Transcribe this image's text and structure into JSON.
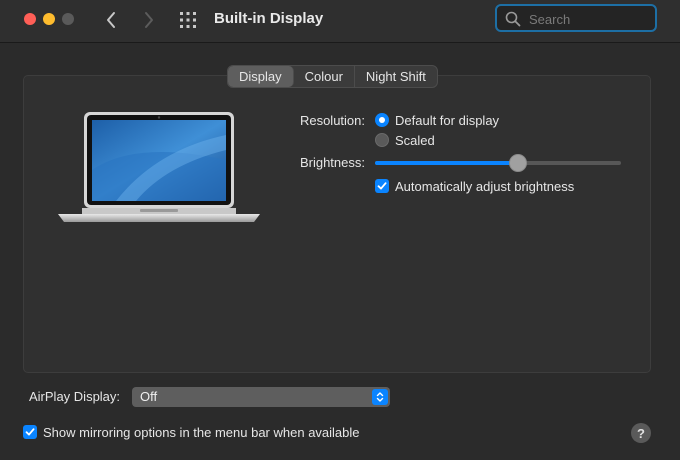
{
  "window": {
    "title": "Built-in Display"
  },
  "search": {
    "placeholder": "Search"
  },
  "tabs": [
    {
      "label": "Display",
      "active": true
    },
    {
      "label": "Colour",
      "active": false
    },
    {
      "label": "Night Shift",
      "active": false
    }
  ],
  "resolution": {
    "label": "Resolution:",
    "options": [
      {
        "label": "Default for display",
        "selected": true
      },
      {
        "label": "Scaled",
        "selected": false
      }
    ]
  },
  "brightness": {
    "label": "Brightness:",
    "level": 0.58,
    "auto_adjust_label": "Automatically adjust brightness",
    "auto_adjust_checked": true
  },
  "airplay": {
    "label": "AirPlay Display:",
    "value": "Off"
  },
  "mirroring": {
    "label": "Show mirroring options in the menu bar when available",
    "checked": true
  },
  "help": {
    "label": "?"
  },
  "colors": {
    "accent": "#0a84ff",
    "window_bg": "#2b2b2b",
    "panel_bg": "#303030",
    "search_focus": "#1d6fa5"
  }
}
